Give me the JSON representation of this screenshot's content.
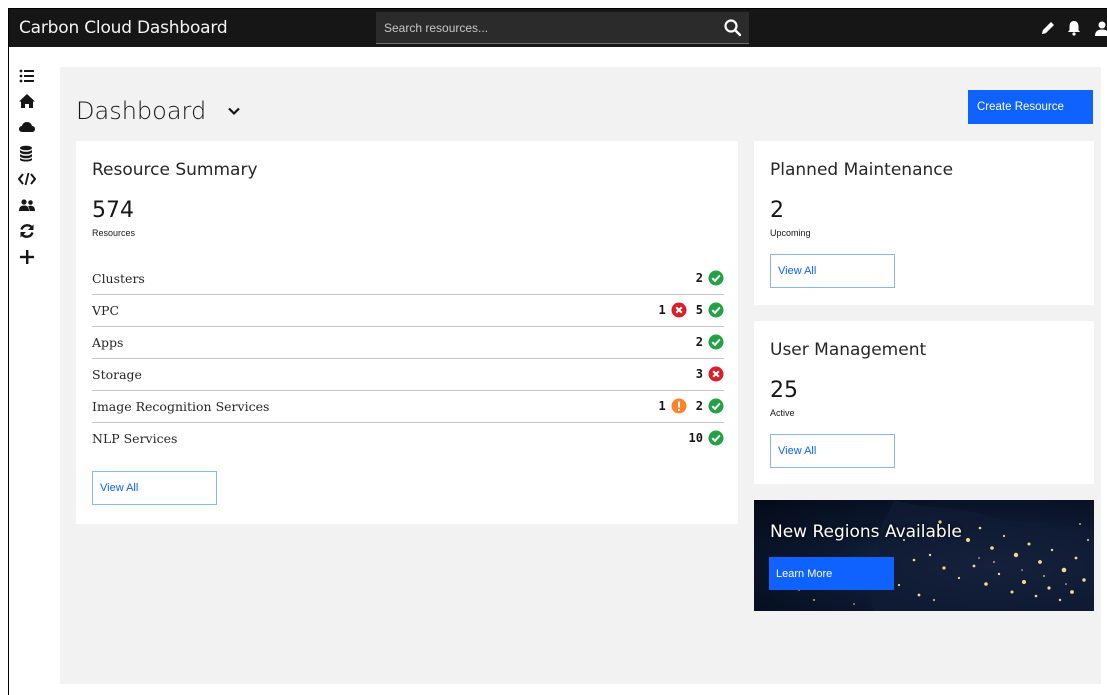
{
  "header": {
    "app_title": "Carbon Cloud Dashboard",
    "search_placeholder": "Search resources...",
    "icons": [
      "search-icon",
      "pencil-icon",
      "bell-icon",
      "user-icon"
    ]
  },
  "sidebar": {
    "icons": [
      "list-icon",
      "home-icon",
      "cloud-icon",
      "database-icon",
      "code-icon",
      "users-icon",
      "refresh-icon",
      "add-icon"
    ]
  },
  "page": {
    "title": "Dashboard",
    "create_button": "Create Resource"
  },
  "resource_summary": {
    "title": "Resource Summary",
    "total": "574",
    "total_label": "Resources",
    "rows": [
      {
        "name": "Clusters",
        "error": null,
        "warning": null,
        "ok": "2"
      },
      {
        "name": "VPC",
        "error": "1",
        "warning": null,
        "ok": "5"
      },
      {
        "name": "Apps",
        "error": null,
        "warning": null,
        "ok": "2"
      },
      {
        "name": "Storage",
        "error": "3",
        "warning": null,
        "ok": null
      },
      {
        "name": "Image Recognition Services",
        "error": null,
        "warning": "1",
        "ok": "2"
      },
      {
        "name": "NLP Services",
        "error": null,
        "warning": null,
        "ok": "10"
      }
    ],
    "view_all": "View All"
  },
  "planned_maintenance": {
    "title": "Planned Maintenance",
    "count": "2",
    "count_label": "Upcoming",
    "view_all": "View All"
  },
  "user_management": {
    "title": "User Management",
    "count": "25",
    "count_label": "Active",
    "view_all": "View All"
  },
  "regions_banner": {
    "title": "New Regions Available",
    "button": "Learn More"
  },
  "colors": {
    "header_bg": "#161616",
    "primary": "#0f62fe",
    "success": "#24a148",
    "error": "#da1e28",
    "warning": "#ff832b",
    "content_bg": "#f2f2f2"
  }
}
